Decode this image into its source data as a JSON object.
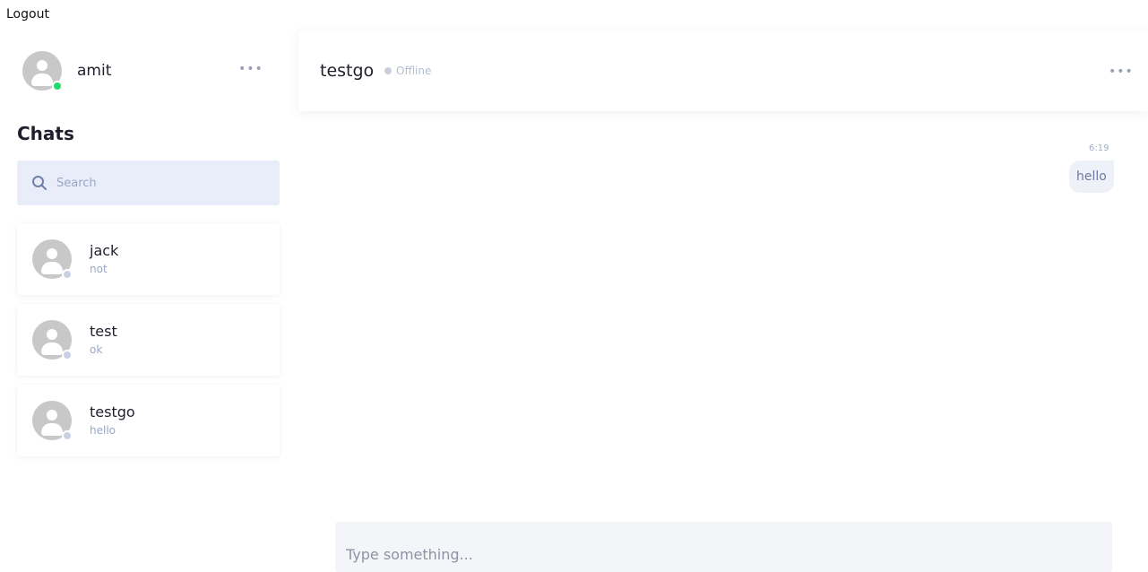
{
  "app": {
    "logout_label": "Logout"
  },
  "me": {
    "name": "amit",
    "status_color": "#1fdc6a",
    "menu_icon": "more-horizontal-icon"
  },
  "sidebar": {
    "title": "Chats",
    "search": {
      "placeholder": "Search",
      "value": "",
      "icon": "search-icon"
    },
    "chats": [
      {
        "name": "jack",
        "last_message": "not",
        "status_color": "#c9d1e6"
      },
      {
        "name": "test",
        "last_message": "ok",
        "status_color": "#c9d1e6"
      },
      {
        "name": "testgo",
        "last_message": "hello",
        "status_color": "#c9d1e6"
      }
    ]
  },
  "conversation": {
    "peer_name": "testgo",
    "peer_status": "Offline",
    "menu_icon": "more-horizontal-icon",
    "messages": [
      {
        "time": "6:19",
        "text": "hello",
        "direction": "outgoing"
      }
    ],
    "composer": {
      "placeholder": "Type something...",
      "value": ""
    }
  },
  "colors": {
    "accent_search_bg": "#e8edf9",
    "online": "#1fdc6a",
    "offline": "#c9d1e6"
  }
}
